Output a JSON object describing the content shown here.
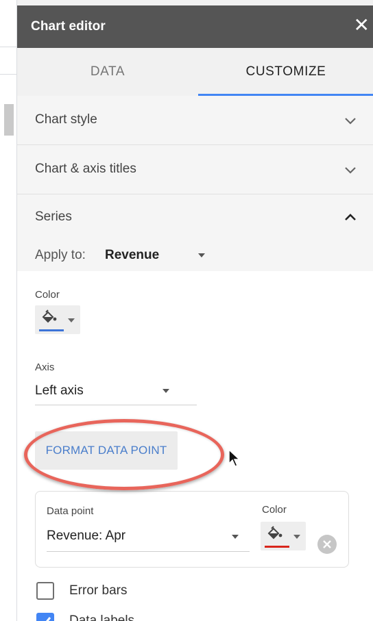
{
  "panel": {
    "title": "Chart editor",
    "close_icon": "close-icon"
  },
  "tabs": [
    {
      "label": "DATA",
      "active": false
    },
    {
      "label": "CUSTOMIZE",
      "active": true
    }
  ],
  "sections": {
    "chart_style": {
      "label": "Chart style",
      "expanded": false
    },
    "axis_titles": {
      "label": "Chart & axis titles",
      "expanded": false
    },
    "series": {
      "label": "Series",
      "expanded": true
    }
  },
  "series": {
    "apply_to_label": "Apply to:",
    "apply_to_value": "Revenue",
    "color_label": "Color",
    "color_value": "#3d74d8",
    "axis_label": "Axis",
    "axis_value": "Left axis",
    "format_button": "FORMAT DATA POINT"
  },
  "data_point": {
    "label": "Data point",
    "value": "Revenue: Apr",
    "color_label": "Color",
    "color_value": "#d9261c"
  },
  "checkboxes": [
    {
      "label": "Error bars",
      "checked": false
    },
    {
      "label": "Data labels",
      "checked": true
    }
  ],
  "colors": {
    "header": "#555555",
    "tab_underline": "#4285f4",
    "annotation": "#e8655b",
    "link_blue": "#4a7ecb"
  }
}
